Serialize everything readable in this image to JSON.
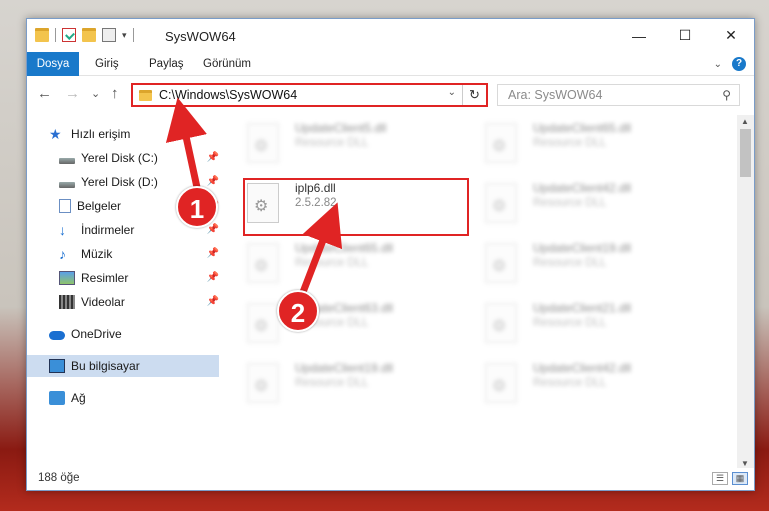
{
  "window": {
    "title": "SysWOW64",
    "controls": {
      "minimize": "—",
      "maximize": "☐",
      "close": "✕"
    }
  },
  "ribbon": {
    "tabs": [
      "Dosya",
      "Giriş",
      "Paylaş",
      "Görünüm"
    ]
  },
  "navigation": {
    "back": "←",
    "forward": "→",
    "recent": "⌄",
    "up": "↑",
    "address_path": "C:\\Windows\\SysWOW64",
    "refresh": "↻",
    "search_placeholder": "Ara: SysWOW64"
  },
  "sidebar": {
    "items": [
      {
        "label": "Hızlı erişim",
        "icon": "star-icon",
        "pinned": false
      },
      {
        "label": "Yerel Disk (C:)",
        "icon": "drive-icon",
        "pinned": true
      },
      {
        "label": "Yerel Disk (D:)",
        "icon": "drive-icon",
        "pinned": true
      },
      {
        "label": "Belgeler",
        "icon": "document-icon",
        "pinned": true
      },
      {
        "label": "İndirmeler",
        "icon": "download-icon",
        "pinned": true
      },
      {
        "label": "Müzik",
        "icon": "music-icon",
        "pinned": true
      },
      {
        "label": "Resimler",
        "icon": "pictures-icon",
        "pinned": true
      },
      {
        "label": "Videolar",
        "icon": "videos-icon",
        "pinned": true
      },
      {
        "label": "OneDrive",
        "icon": "cloud-icon",
        "pinned": false
      },
      {
        "label": "Bu bilgisayar",
        "icon": "computer-icon",
        "pinned": false,
        "selected": true
      },
      {
        "label": "Ağ",
        "icon": "network-icon",
        "pinned": false
      }
    ],
    "pin_glyph": "📌"
  },
  "files": {
    "highlighted": {
      "name": "iplp6.dll",
      "version": "2.5.2.82"
    },
    "background": [
      {
        "name": "UpdateClient5.dll",
        "desc": "Resource DLL"
      },
      {
        "name": "UpdateClient65.dll",
        "desc": "Resource DLL"
      },
      {
        "name": "UpdateClient42.dll",
        "desc": "Resource DLL"
      },
      {
        "name": "UpdateClient65.dll",
        "desc": "Resource DLL"
      },
      {
        "name": "UpdateClient19.dll",
        "desc": "Resource DLL"
      },
      {
        "name": "UpdateClient63.dll",
        "desc": "Resource DLL"
      },
      {
        "name": "UpdateClient21.dll",
        "desc": "Resource DLL"
      },
      {
        "name": "UpdateClient19.dll",
        "desc": "Resource DLL"
      },
      {
        "name": "UpdateClient42.dll",
        "desc": "Resource DLL"
      }
    ]
  },
  "status": {
    "item_count": "188 öğe"
  },
  "callouts": [
    "1",
    "2"
  ],
  "colors": {
    "accent": "#1979ca",
    "highlight": "#e02424",
    "selected": "#ccdcf0"
  }
}
